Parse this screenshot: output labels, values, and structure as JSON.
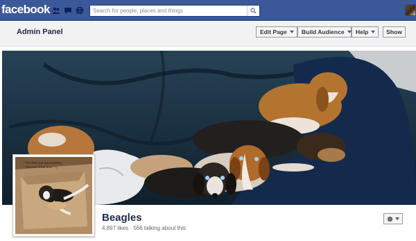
{
  "topbar": {
    "logo": "facebook",
    "search_placeholder": "Search for people, places and things",
    "jewels": [
      "friend-requests-icon",
      "messages-icon",
      "notifications-icon"
    ],
    "colors": {
      "bar": "#3b5998",
      "border": "#133783"
    }
  },
  "adminbar": {
    "title": "Admin Panel",
    "buttons": [
      {
        "label": "Edit Page",
        "has_menu": true
      },
      {
        "label": "Build Audience",
        "has_menu": true
      },
      {
        "label": "Help",
        "has_menu": true
      },
      {
        "label": "Show",
        "has_menu": false
      }
    ]
  },
  "profile": {
    "photo_caption": "The little one was thinking \"Get out of the box!\" :-)",
    "name": "Beagles",
    "stats": "4,897 likes · 566 talking about this",
    "settings_icon": "gear-icon"
  }
}
